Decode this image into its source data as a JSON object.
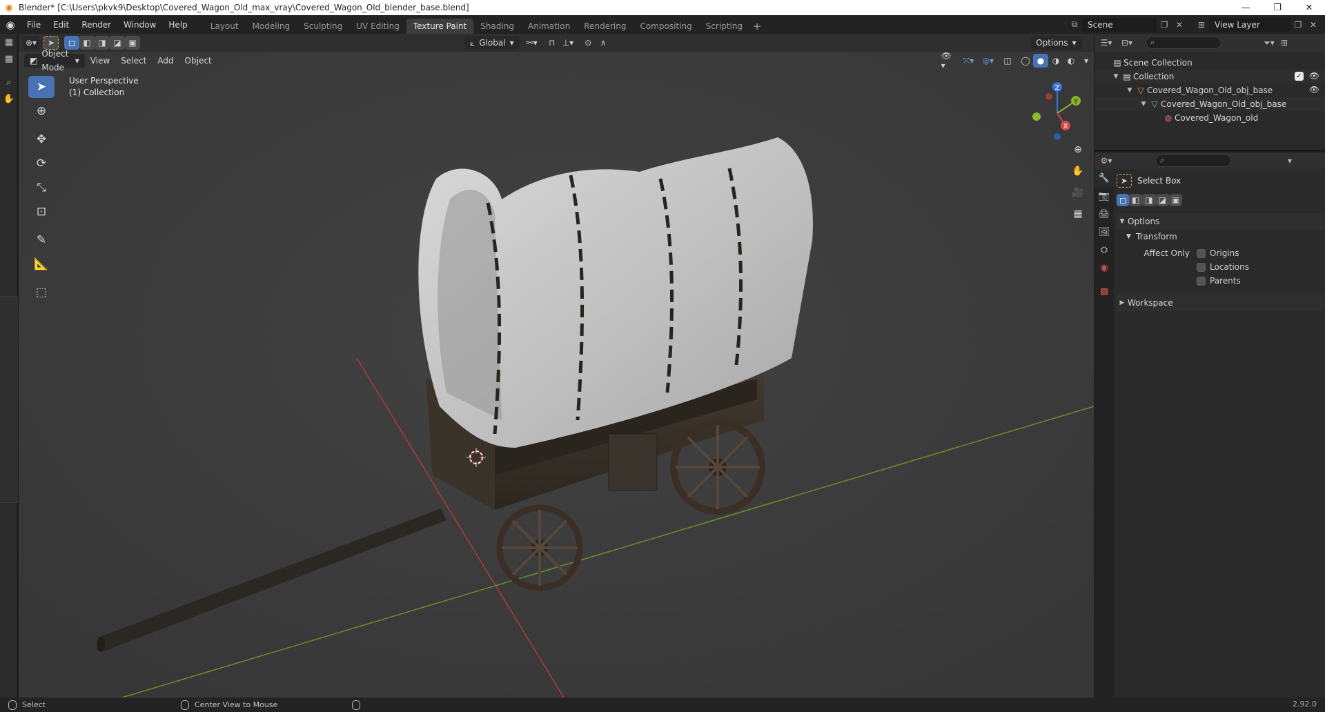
{
  "window": {
    "title": "Blender* [C:\\Users\\pkvk9\\Desktop\\Covered_Wagon_Old_max_vray\\Covered_Wagon_Old_blender_base.blend]",
    "minimize": "—",
    "maximize": "❐",
    "close": "✕"
  },
  "menu": [
    "File",
    "Edit",
    "Render",
    "Window",
    "Help"
  ],
  "workspaces": [
    "Layout",
    "Modeling",
    "Sculpting",
    "UV Editing",
    "Texture Paint",
    "Shading",
    "Animation",
    "Rendering",
    "Compositing",
    "Scripting"
  ],
  "active_workspace_index": 4,
  "scene_name": "Scene",
  "view_layer": "View Layer",
  "viewport": {
    "mode": "Object Mode",
    "menus": [
      "View",
      "Select",
      "Add",
      "Object"
    ],
    "transform_orientation": "Global",
    "options_label": "Options",
    "info_line1": "User Perspective",
    "info_line2": "(1) Collection",
    "gizmo_axes": {
      "z": "Z",
      "y": "Y",
      "x": "X"
    }
  },
  "outliner": {
    "rows": [
      {
        "label": "Scene Collection",
        "level": 0,
        "icon": "scene-collection-icon"
      },
      {
        "label": "Collection",
        "level": 1,
        "icon": "collection-icon"
      },
      {
        "label": "Covered_Wagon_Old_obj_base",
        "level": 2,
        "icon": "object-icon"
      },
      {
        "label": "Covered_Wagon_Old_obj_base",
        "level": 3,
        "icon": "mesh-icon"
      },
      {
        "label": "Covered_Wagon_old",
        "level": 4,
        "icon": "material-icon"
      }
    ]
  },
  "properties": {
    "tool_name": "Select Box",
    "section_options": "Options",
    "subsection_transform": "Transform",
    "affect_only_label": "Affect Only",
    "checkboxes": [
      "Origins",
      "Locations",
      "Parents"
    ],
    "section_workspace": "Workspace"
  },
  "statusbar": {
    "left_action": "Select",
    "middle_action": "Center View to Mouse",
    "version": "2.92.0"
  }
}
